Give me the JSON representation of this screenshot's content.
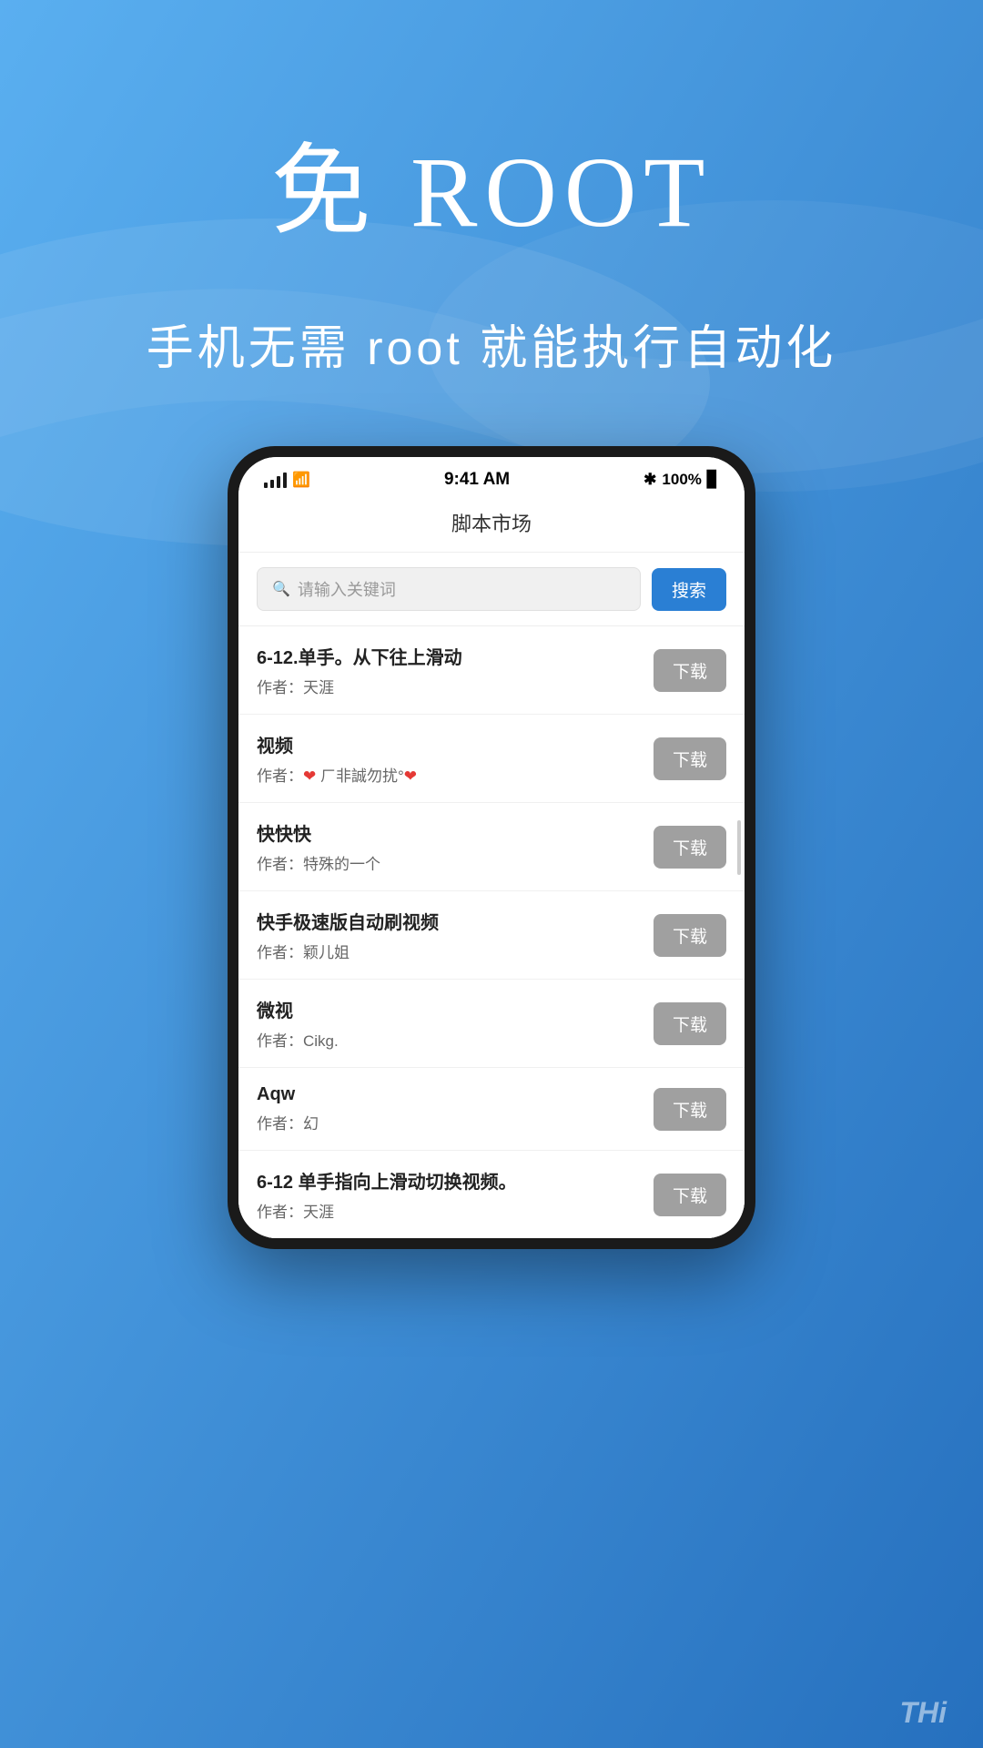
{
  "hero": {
    "title": "免 ROOT",
    "subtitle": "手机无需 root 就能执行自动化"
  },
  "status_bar": {
    "time": "9:41 AM",
    "battery": "100%",
    "bluetooth": "✱"
  },
  "app": {
    "header_title": "脚本市场",
    "search_placeholder": "请输入关键词",
    "search_button": "搜索"
  },
  "scripts": [
    {
      "name": "6-12.单手。从下往上滑动",
      "author": "作者：天涯",
      "download_label": "下载"
    },
    {
      "name": "视频",
      "author_raw": "作者：❤ ㄏ非誠勿扰°❤",
      "author_label": "作者：",
      "download_label": "下载"
    },
    {
      "name": "快快快",
      "author": "作者：特殊的一个",
      "download_label": "下载"
    },
    {
      "name": "快手极速版自动刷视频",
      "author": "作者：颖儿姐",
      "download_label": "下载"
    },
    {
      "name": "微视",
      "author": "作者：Cikg.",
      "download_label": "下载"
    },
    {
      "name": "Aqw",
      "author": "作者：幻",
      "download_label": "下载"
    },
    {
      "name": "6-12 单手指向上滑动切换视频。",
      "author": "作者：天涯",
      "download_label": "下载"
    }
  ],
  "watermark": "THi"
}
